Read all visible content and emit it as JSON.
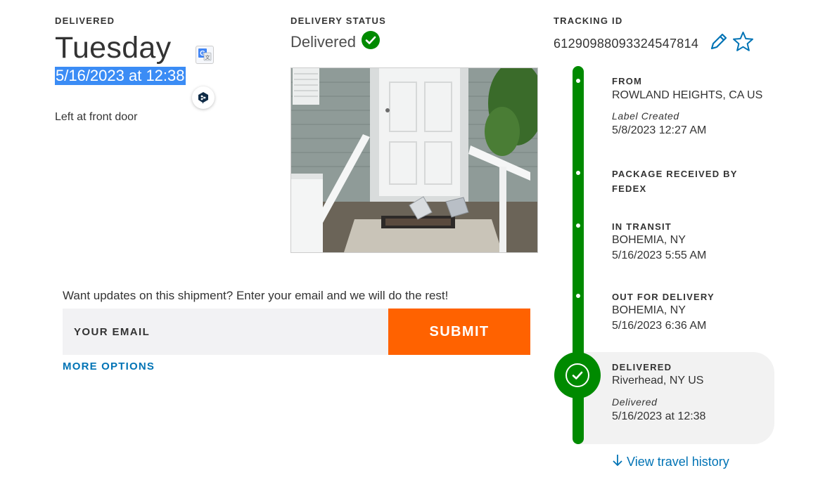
{
  "colors": {
    "accent_green": "#008a00",
    "submit_orange": "#ff6200",
    "link_blue": "#0073b5",
    "selection_blue": "#3b8cf5"
  },
  "delivered_block": {
    "label": "DELIVERED",
    "day": "Tuesday",
    "datetime": "5/16/2023 at 12:38",
    "note": "Left at front door"
  },
  "status_block": {
    "label": "DELIVERY STATUS",
    "value": "Delivered"
  },
  "tracking_block": {
    "label": "TRACKING ID",
    "number": "612909880933245478​14"
  },
  "email_form": {
    "prompt": "Want updates on this shipment? Enter your email and we will do the rest!",
    "placeholder": "YOUR EMAIL",
    "submit_label": "SUBMIT",
    "more_options": "MORE OPTIONS"
  },
  "timeline": {
    "events": [
      {
        "title": "FROM",
        "location": "ROWLAND HEIGHTS, CA US",
        "sub": "Label Created",
        "time": "5/8/2023 12:27 AM"
      },
      {
        "title": "PACKAGE RECEIVED BY",
        "title2": "FEDEX"
      },
      {
        "title": "IN TRANSIT",
        "location": "BOHEMIA, NY",
        "time": "5/16/2023 5:55 AM"
      },
      {
        "title": "OUT FOR DELIVERY",
        "location": "BOHEMIA, NY",
        "time": "5/16/2023 6:36 AM"
      },
      {
        "title": "DELIVERED",
        "location": "Riverhead, NY US",
        "sub": "Delivered",
        "time": "5/16/2023 at 12:38"
      }
    ],
    "history_link": "View travel history"
  },
  "icons": [
    "google-translate-icon",
    "deepl-icon",
    "check-circle-icon",
    "pencil-icon",
    "star-icon",
    "arrow-down-icon"
  ]
}
